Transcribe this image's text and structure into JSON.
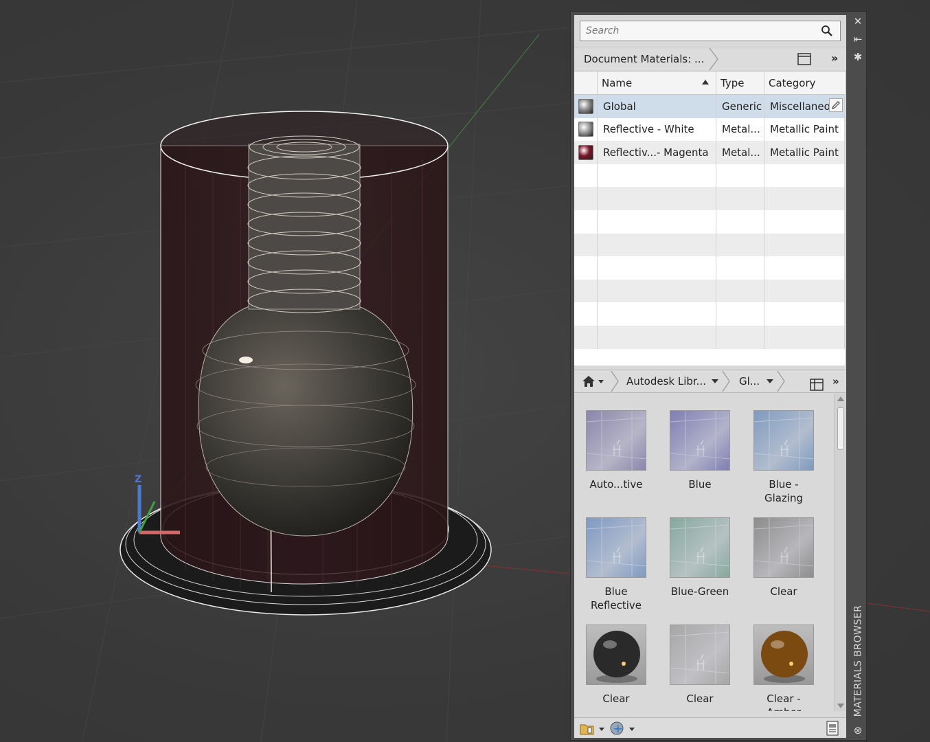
{
  "search": {
    "placeholder": "Search"
  },
  "document_bar": {
    "breadcrumb": "Document Materials: ...",
    "more": "»"
  },
  "table": {
    "headers": [
      "Name",
      "Type",
      "Category"
    ],
    "rows": [
      {
        "name": "Global",
        "type": "Generic",
        "category": "Miscellaneous",
        "swatch": "#8a8a8a",
        "selected": true
      },
      {
        "name": "Reflective - White",
        "type": "Metal...",
        "category": "Metallic Paint",
        "swatch": "#9a9a9a",
        "selected": false
      },
      {
        "name": "Reflectiv...- Magenta",
        "type": "Metal...",
        "category": "Metallic Paint",
        "swatch": "#7a1428",
        "selected": false
      }
    ]
  },
  "library_bar": {
    "library": "Autodesk Libr...",
    "category": "Gl...",
    "more": "»"
  },
  "library_items": [
    {
      "label": "Auto...tive",
      "tint": "#8a86ac"
    },
    {
      "label": "Blue",
      "tint": "#7f7fb4"
    },
    {
      "label": "Blue - Glazing",
      "tint": "#7f9cc0"
    },
    {
      "label": "Blue Reflective",
      "tint": "#7f9ac2"
    },
    {
      "label": "Blue-Green",
      "tint": "#86a89e"
    },
    {
      "label": "Clear",
      "tint": "#8d8d8d"
    },
    {
      "label": "Clear",
      "tint": "#2a2a2a"
    },
    {
      "label": "Clear",
      "tint": "#a7a7a7"
    },
    {
      "label": "Clear - Amber",
      "tint": "#7a4a10"
    }
  ],
  "palette_title": "MATERIALS BROWSER",
  "colors": {
    "selection": "#cfdcea",
    "panel": "#d9d9d9",
    "viewport": "#3b3b3b"
  }
}
